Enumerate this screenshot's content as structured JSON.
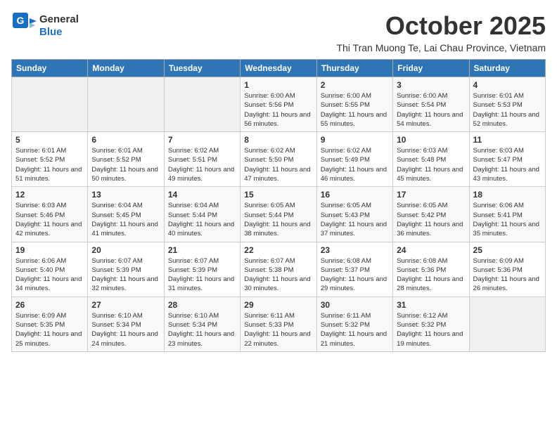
{
  "logo": {
    "line1": "General",
    "line2": "Blue"
  },
  "title": "October 2025",
  "subtitle": "Thi Tran Muong Te, Lai Chau Province, Vietnam",
  "days_of_week": [
    "Sunday",
    "Monday",
    "Tuesday",
    "Wednesday",
    "Thursday",
    "Friday",
    "Saturday"
  ],
  "weeks": [
    [
      {
        "day": "",
        "info": ""
      },
      {
        "day": "",
        "info": ""
      },
      {
        "day": "",
        "info": ""
      },
      {
        "day": "1",
        "info": "Sunrise: 6:00 AM\nSunset: 5:56 PM\nDaylight: 11 hours and 56 minutes."
      },
      {
        "day": "2",
        "info": "Sunrise: 6:00 AM\nSunset: 5:55 PM\nDaylight: 11 hours and 55 minutes."
      },
      {
        "day": "3",
        "info": "Sunrise: 6:00 AM\nSunset: 5:54 PM\nDaylight: 11 hours and 54 minutes."
      },
      {
        "day": "4",
        "info": "Sunrise: 6:01 AM\nSunset: 5:53 PM\nDaylight: 11 hours and 52 minutes."
      }
    ],
    [
      {
        "day": "5",
        "info": "Sunrise: 6:01 AM\nSunset: 5:52 PM\nDaylight: 11 hours and 51 minutes."
      },
      {
        "day": "6",
        "info": "Sunrise: 6:01 AM\nSunset: 5:52 PM\nDaylight: 11 hours and 50 minutes."
      },
      {
        "day": "7",
        "info": "Sunrise: 6:02 AM\nSunset: 5:51 PM\nDaylight: 11 hours and 49 minutes."
      },
      {
        "day": "8",
        "info": "Sunrise: 6:02 AM\nSunset: 5:50 PM\nDaylight: 11 hours and 47 minutes."
      },
      {
        "day": "9",
        "info": "Sunrise: 6:02 AM\nSunset: 5:49 PM\nDaylight: 11 hours and 46 minutes."
      },
      {
        "day": "10",
        "info": "Sunrise: 6:03 AM\nSunset: 5:48 PM\nDaylight: 11 hours and 45 minutes."
      },
      {
        "day": "11",
        "info": "Sunrise: 6:03 AM\nSunset: 5:47 PM\nDaylight: 11 hours and 43 minutes."
      }
    ],
    [
      {
        "day": "12",
        "info": "Sunrise: 6:03 AM\nSunset: 5:46 PM\nDaylight: 11 hours and 42 minutes."
      },
      {
        "day": "13",
        "info": "Sunrise: 6:04 AM\nSunset: 5:45 PM\nDaylight: 11 hours and 41 minutes."
      },
      {
        "day": "14",
        "info": "Sunrise: 6:04 AM\nSunset: 5:44 PM\nDaylight: 11 hours and 40 minutes."
      },
      {
        "day": "15",
        "info": "Sunrise: 6:05 AM\nSunset: 5:44 PM\nDaylight: 11 hours and 38 minutes."
      },
      {
        "day": "16",
        "info": "Sunrise: 6:05 AM\nSunset: 5:43 PM\nDaylight: 11 hours and 37 minutes."
      },
      {
        "day": "17",
        "info": "Sunrise: 6:05 AM\nSunset: 5:42 PM\nDaylight: 11 hours and 36 minutes."
      },
      {
        "day": "18",
        "info": "Sunrise: 6:06 AM\nSunset: 5:41 PM\nDaylight: 11 hours and 35 minutes."
      }
    ],
    [
      {
        "day": "19",
        "info": "Sunrise: 6:06 AM\nSunset: 5:40 PM\nDaylight: 11 hours and 34 minutes."
      },
      {
        "day": "20",
        "info": "Sunrise: 6:07 AM\nSunset: 5:39 PM\nDaylight: 11 hours and 32 minutes."
      },
      {
        "day": "21",
        "info": "Sunrise: 6:07 AM\nSunset: 5:39 PM\nDaylight: 11 hours and 31 minutes."
      },
      {
        "day": "22",
        "info": "Sunrise: 6:07 AM\nSunset: 5:38 PM\nDaylight: 11 hours and 30 minutes."
      },
      {
        "day": "23",
        "info": "Sunrise: 6:08 AM\nSunset: 5:37 PM\nDaylight: 11 hours and 29 minutes."
      },
      {
        "day": "24",
        "info": "Sunrise: 6:08 AM\nSunset: 5:36 PM\nDaylight: 11 hours and 28 minutes."
      },
      {
        "day": "25",
        "info": "Sunrise: 6:09 AM\nSunset: 5:36 PM\nDaylight: 11 hours and 26 minutes."
      }
    ],
    [
      {
        "day": "26",
        "info": "Sunrise: 6:09 AM\nSunset: 5:35 PM\nDaylight: 11 hours and 25 minutes."
      },
      {
        "day": "27",
        "info": "Sunrise: 6:10 AM\nSunset: 5:34 PM\nDaylight: 11 hours and 24 minutes."
      },
      {
        "day": "28",
        "info": "Sunrise: 6:10 AM\nSunset: 5:34 PM\nDaylight: 11 hours and 23 minutes."
      },
      {
        "day": "29",
        "info": "Sunrise: 6:11 AM\nSunset: 5:33 PM\nDaylight: 11 hours and 22 minutes."
      },
      {
        "day": "30",
        "info": "Sunrise: 6:11 AM\nSunset: 5:32 PM\nDaylight: 11 hours and 21 minutes."
      },
      {
        "day": "31",
        "info": "Sunrise: 6:12 AM\nSunset: 5:32 PM\nDaylight: 11 hours and 19 minutes."
      },
      {
        "day": "",
        "info": ""
      }
    ]
  ]
}
